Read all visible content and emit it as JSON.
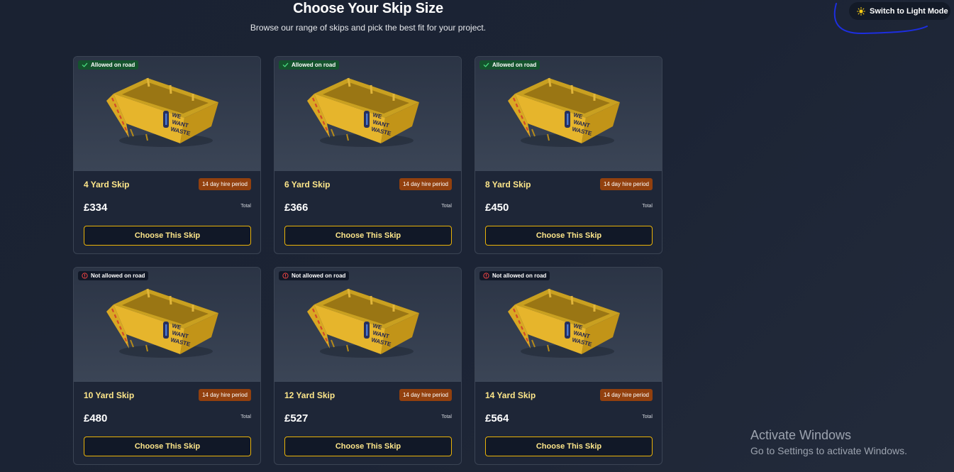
{
  "header": {
    "title": "Choose Your Skip Size",
    "subtitle": "Browse our range of skips and pick the best fit for your project."
  },
  "theme_toggle": {
    "label": "Switch to Light Mode",
    "icon": "sun-icon"
  },
  "colors": {
    "accent": "#eab308",
    "accent_text": "#fde68a",
    "allowed_badge": "#14532d",
    "not_allowed_badge": "#111827",
    "hire_badge": "#92400e"
  },
  "skip_logo": {
    "line1": "WE",
    "line2": "WANT",
    "line3": "WASTE"
  },
  "skips": [
    {
      "name": "4 Yard Skip",
      "hire": "14 day hire period",
      "price": "£334",
      "total_label": "Total",
      "road_status": "Allowed on road",
      "allowed": true,
      "button": "Choose This Skip"
    },
    {
      "name": "6 Yard Skip",
      "hire": "14 day hire period",
      "price": "£366",
      "total_label": "Total",
      "road_status": "Allowed on road",
      "allowed": true,
      "button": "Choose This Skip"
    },
    {
      "name": "8 Yard Skip",
      "hire": "14 day hire period",
      "price": "£450",
      "total_label": "Total",
      "road_status": "Allowed on road",
      "allowed": true,
      "button": "Choose This Skip"
    },
    {
      "name": "10 Yard Skip",
      "hire": "14 day hire period",
      "price": "£480",
      "total_label": "Total",
      "road_status": "Not allowed on road",
      "allowed": false,
      "button": "Choose This Skip"
    },
    {
      "name": "12 Yard Skip",
      "hire": "14 day hire period",
      "price": "£527",
      "total_label": "Total",
      "road_status": "Not allowed on road",
      "allowed": false,
      "button": "Choose This Skip"
    },
    {
      "name": "14 Yard Skip",
      "hire": "14 day hire period",
      "price": "£564",
      "total_label": "Total",
      "road_status": "Not allowed on road",
      "allowed": false,
      "button": "Choose This Skip"
    }
  ],
  "watermark": {
    "title": "Activate Windows",
    "subtitle": "Go to Settings to activate Windows."
  }
}
